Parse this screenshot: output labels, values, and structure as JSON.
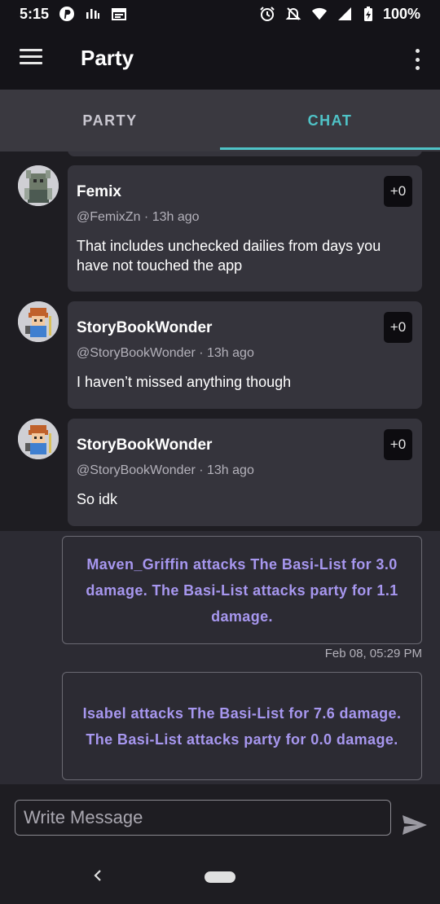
{
  "status_bar": {
    "time": "5:15",
    "battery": "100%",
    "icons": [
      "pinterest-icon",
      "signal-bars-icon",
      "calendar-icon",
      "alarm-icon",
      "notifications-off-icon",
      "wifi-icon",
      "cell-signal-icon",
      "battery-charging-icon"
    ]
  },
  "app_bar": {
    "title": "Party"
  },
  "tabs": [
    {
      "label": "PARTY",
      "active": false
    },
    {
      "label": "CHAT",
      "active": true
    }
  ],
  "messages": [
    {
      "author": "Femix",
      "meta": "@FemixZn · 13h ago",
      "text": "That includes unchecked dailies from days you have not touched the app",
      "likes": "+0"
    },
    {
      "author": "StoryBookWonder",
      "meta": "@StoryBookWonder · 13h ago",
      "text": "I haven’t missed anything though",
      "likes": "+0"
    },
    {
      "author": "StoryBookWonder",
      "meta": "@StoryBookWonder · 13h ago",
      "text": "So idk",
      "likes": "+0"
    }
  ],
  "system_messages": [
    {
      "text": "Maven_Griffin attacks The Basi-List for 3.0 damage. The Basi-List attacks party for 1.1 damage.",
      "time": "Feb 08, 05:29 PM"
    },
    {
      "text": "Isabel attacks The Basi-List for 7.6 damage. The Basi-List attacks party for 0.0 damage.",
      "time": ""
    }
  ],
  "input": {
    "placeholder": "Write Message",
    "value": ""
  },
  "colors": {
    "accent": "#4fc3c7",
    "system_text": "#a797ef",
    "card_bg": "#35343c",
    "background": "#1e1d22"
  }
}
